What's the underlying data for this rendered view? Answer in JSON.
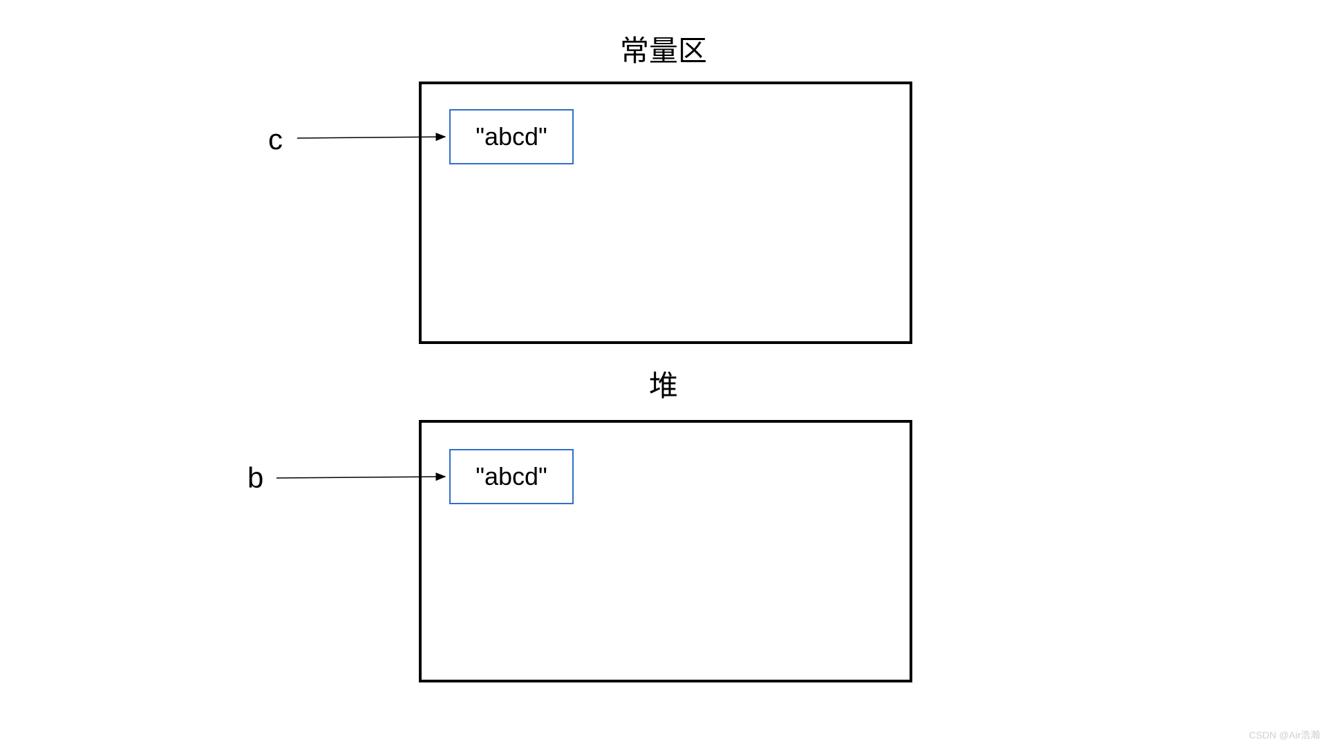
{
  "regions": {
    "constant": {
      "title": "常量区",
      "pointer_var": "c",
      "string_value": "\"abcd\""
    },
    "heap": {
      "title": "堆",
      "pointer_var": "b",
      "string_value": "\"abcd\""
    }
  },
  "watermark": "CSDN @Air浩瀚"
}
